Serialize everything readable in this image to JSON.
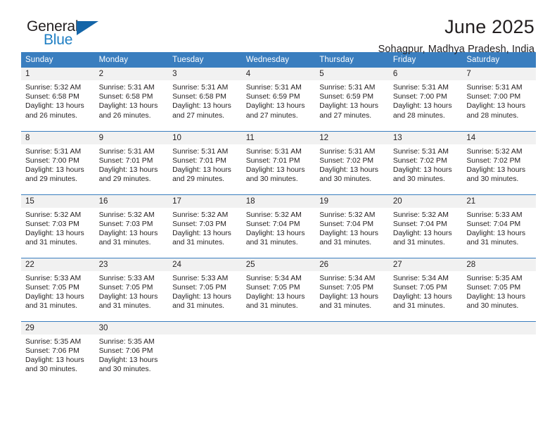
{
  "logo": {
    "word_one": "General",
    "word_two": "Blue",
    "triangle_color": "#1465a8",
    "blue_text_color": "#1f7fc4"
  },
  "header": {
    "month_title": "June 2025",
    "location": "Sohagpur, Madhya Pradesh, India"
  },
  "theme": {
    "header_row_bg": "#3a7ebf",
    "header_row_text": "#ffffff",
    "daynum_bg": "#f1f1f1",
    "row_divider": "#3a7ebf",
    "body_text": "#231f20"
  },
  "weekday_headers": [
    "Sunday",
    "Monday",
    "Tuesday",
    "Wednesday",
    "Thursday",
    "Friday",
    "Saturday"
  ],
  "weeks": [
    [
      {
        "day": "1",
        "sunrise": "Sunrise: 5:32 AM",
        "sunset": "Sunset: 6:58 PM",
        "daylight": "Daylight: 13 hours and 26 minutes."
      },
      {
        "day": "2",
        "sunrise": "Sunrise: 5:31 AM",
        "sunset": "Sunset: 6:58 PM",
        "daylight": "Daylight: 13 hours and 26 minutes."
      },
      {
        "day": "3",
        "sunrise": "Sunrise: 5:31 AM",
        "sunset": "Sunset: 6:58 PM",
        "daylight": "Daylight: 13 hours and 27 minutes."
      },
      {
        "day": "4",
        "sunrise": "Sunrise: 5:31 AM",
        "sunset": "Sunset: 6:59 PM",
        "daylight": "Daylight: 13 hours and 27 minutes."
      },
      {
        "day": "5",
        "sunrise": "Sunrise: 5:31 AM",
        "sunset": "Sunset: 6:59 PM",
        "daylight": "Daylight: 13 hours and 27 minutes."
      },
      {
        "day": "6",
        "sunrise": "Sunrise: 5:31 AM",
        "sunset": "Sunset: 7:00 PM",
        "daylight": "Daylight: 13 hours and 28 minutes."
      },
      {
        "day": "7",
        "sunrise": "Sunrise: 5:31 AM",
        "sunset": "Sunset: 7:00 PM",
        "daylight": "Daylight: 13 hours and 28 minutes."
      }
    ],
    [
      {
        "day": "8",
        "sunrise": "Sunrise: 5:31 AM",
        "sunset": "Sunset: 7:00 PM",
        "daylight": "Daylight: 13 hours and 29 minutes."
      },
      {
        "day": "9",
        "sunrise": "Sunrise: 5:31 AM",
        "sunset": "Sunset: 7:01 PM",
        "daylight": "Daylight: 13 hours and 29 minutes."
      },
      {
        "day": "10",
        "sunrise": "Sunrise: 5:31 AM",
        "sunset": "Sunset: 7:01 PM",
        "daylight": "Daylight: 13 hours and 29 minutes."
      },
      {
        "day": "11",
        "sunrise": "Sunrise: 5:31 AM",
        "sunset": "Sunset: 7:01 PM",
        "daylight": "Daylight: 13 hours and 30 minutes."
      },
      {
        "day": "12",
        "sunrise": "Sunrise: 5:31 AM",
        "sunset": "Sunset: 7:02 PM",
        "daylight": "Daylight: 13 hours and 30 minutes."
      },
      {
        "day": "13",
        "sunrise": "Sunrise: 5:31 AM",
        "sunset": "Sunset: 7:02 PM",
        "daylight": "Daylight: 13 hours and 30 minutes."
      },
      {
        "day": "14",
        "sunrise": "Sunrise: 5:32 AM",
        "sunset": "Sunset: 7:02 PM",
        "daylight": "Daylight: 13 hours and 30 minutes."
      }
    ],
    [
      {
        "day": "15",
        "sunrise": "Sunrise: 5:32 AM",
        "sunset": "Sunset: 7:03 PM",
        "daylight": "Daylight: 13 hours and 31 minutes."
      },
      {
        "day": "16",
        "sunrise": "Sunrise: 5:32 AM",
        "sunset": "Sunset: 7:03 PM",
        "daylight": "Daylight: 13 hours and 31 minutes."
      },
      {
        "day": "17",
        "sunrise": "Sunrise: 5:32 AM",
        "sunset": "Sunset: 7:03 PM",
        "daylight": "Daylight: 13 hours and 31 minutes."
      },
      {
        "day": "18",
        "sunrise": "Sunrise: 5:32 AM",
        "sunset": "Sunset: 7:04 PM",
        "daylight": "Daylight: 13 hours and 31 minutes."
      },
      {
        "day": "19",
        "sunrise": "Sunrise: 5:32 AM",
        "sunset": "Sunset: 7:04 PM",
        "daylight": "Daylight: 13 hours and 31 minutes."
      },
      {
        "day": "20",
        "sunrise": "Sunrise: 5:32 AM",
        "sunset": "Sunset: 7:04 PM",
        "daylight": "Daylight: 13 hours and 31 minutes."
      },
      {
        "day": "21",
        "sunrise": "Sunrise: 5:33 AM",
        "sunset": "Sunset: 7:04 PM",
        "daylight": "Daylight: 13 hours and 31 minutes."
      }
    ],
    [
      {
        "day": "22",
        "sunrise": "Sunrise: 5:33 AM",
        "sunset": "Sunset: 7:05 PM",
        "daylight": "Daylight: 13 hours and 31 minutes."
      },
      {
        "day": "23",
        "sunrise": "Sunrise: 5:33 AM",
        "sunset": "Sunset: 7:05 PM",
        "daylight": "Daylight: 13 hours and 31 minutes."
      },
      {
        "day": "24",
        "sunrise": "Sunrise: 5:33 AM",
        "sunset": "Sunset: 7:05 PM",
        "daylight": "Daylight: 13 hours and 31 minutes."
      },
      {
        "day": "25",
        "sunrise": "Sunrise: 5:34 AM",
        "sunset": "Sunset: 7:05 PM",
        "daylight": "Daylight: 13 hours and 31 minutes."
      },
      {
        "day": "26",
        "sunrise": "Sunrise: 5:34 AM",
        "sunset": "Sunset: 7:05 PM",
        "daylight": "Daylight: 13 hours and 31 minutes."
      },
      {
        "day": "27",
        "sunrise": "Sunrise: 5:34 AM",
        "sunset": "Sunset: 7:05 PM",
        "daylight": "Daylight: 13 hours and 31 minutes."
      },
      {
        "day": "28",
        "sunrise": "Sunrise: 5:35 AM",
        "sunset": "Sunset: 7:05 PM",
        "daylight": "Daylight: 13 hours and 30 minutes."
      }
    ],
    [
      {
        "day": "29",
        "sunrise": "Sunrise: 5:35 AM",
        "sunset": "Sunset: 7:06 PM",
        "daylight": "Daylight: 13 hours and 30 minutes."
      },
      {
        "day": "30",
        "sunrise": "Sunrise: 5:35 AM",
        "sunset": "Sunset: 7:06 PM",
        "daylight": "Daylight: 13 hours and 30 minutes."
      },
      {
        "day": "",
        "sunrise": "",
        "sunset": "",
        "daylight": ""
      },
      {
        "day": "",
        "sunrise": "",
        "sunset": "",
        "daylight": ""
      },
      {
        "day": "",
        "sunrise": "",
        "sunset": "",
        "daylight": ""
      },
      {
        "day": "",
        "sunrise": "",
        "sunset": "",
        "daylight": ""
      },
      {
        "day": "",
        "sunrise": "",
        "sunset": "",
        "daylight": ""
      }
    ]
  ]
}
